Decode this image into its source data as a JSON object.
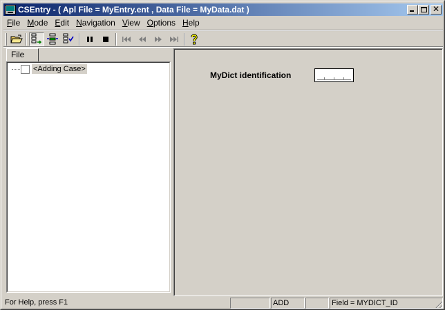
{
  "window": {
    "title": "CSEntry - ( Apl File = MyEntry.ent , Data File = MyData.dat )"
  },
  "menu": [
    {
      "label": "File",
      "accel": "F",
      "rest": "ile"
    },
    {
      "label": "Mode",
      "accel": "M",
      "rest": "ode"
    },
    {
      "label": "Edit",
      "accel": "E",
      "rest": "dit"
    },
    {
      "label": "Navigation",
      "accel": "N",
      "rest": "avigation"
    },
    {
      "label": "View",
      "accel": "V",
      "rest": "iew"
    },
    {
      "label": "Options",
      "accel": "O",
      "rest": "ptions"
    },
    {
      "label": "Help",
      "accel": "H",
      "rest": "elp"
    }
  ],
  "toolbar": {
    "buttons": [
      "open-icon",
      "add-mode-icon",
      "modify-mode-icon",
      "verify-mode-icon",
      "pause-icon",
      "stop-icon",
      "first-icon",
      "previous-icon",
      "next-icon",
      "last-icon",
      "help-icon"
    ]
  },
  "left_pane": {
    "tab_label": "File",
    "tree": {
      "node_label": "<Adding Case>"
    }
  },
  "form": {
    "field_label": "MyDict identification",
    "field_value": ""
  },
  "status": {
    "help_text": "For Help, press F1",
    "panel_1": "",
    "mode": "ADD",
    "panel_3": "",
    "field": "Field = MYDICT_ID"
  }
}
